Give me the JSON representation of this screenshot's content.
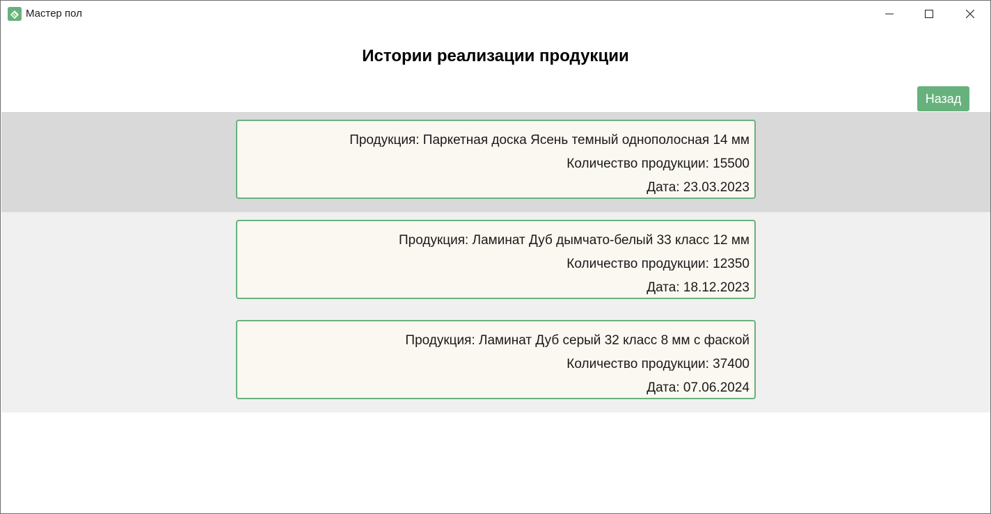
{
  "window": {
    "title": "Мастер пол",
    "icon": "app-logo-icon",
    "controls": [
      "minimize-icon",
      "maximize-icon",
      "close-icon"
    ]
  },
  "page": {
    "title": "Истории реализации продукции"
  },
  "toolbar": {
    "back_label": "Назад"
  },
  "colors": {
    "accent": "#67b27c",
    "card_background": "#fbf7f1",
    "selected_row": "#d9d9d9",
    "list_background": "#f0f0f0"
  },
  "records": [
    {
      "product": "Продукция: Паркетная доска Ясень темный однополосная 14 мм",
      "quantity": "Количество продукции: 15500",
      "date": "Дата: 23.03.2023"
    },
    {
      "product": "Продукция: Ламинат Дуб дымчато-белый 33 класс 12 мм",
      "quantity": "Количество продукции: 12350",
      "date": "Дата: 18.12.2023"
    },
    {
      "product": "Продукция: Ламинат Дуб серый 32 класс 8 мм с фаской",
      "quantity": "Количество продукции: 37400",
      "date": "Дата: 07.06.2024"
    }
  ]
}
